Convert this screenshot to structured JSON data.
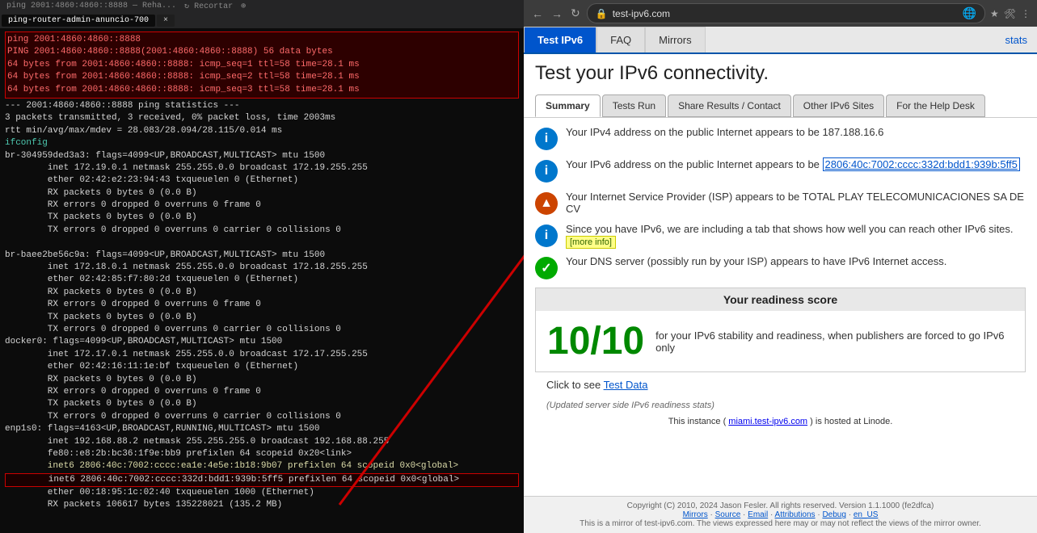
{
  "terminal": {
    "tabs": [
      {
        "label": "ping-router-admin-anuncio-700",
        "active": true
      },
      {
        "label": "×",
        "active": false
      }
    ],
    "lines": [
      {
        "text": "ping 2001:4860:4860::8888",
        "class": "t-red"
      },
      {
        "text": "PING 2001:4860:4860::8888(2001:4860:4860::8888) 56 data bytes",
        "class": "t-red"
      },
      {
        "text": "64 bytes from 2001:4860:4860::8888: icmp_seq=1 ttl=58 time=28.1 ms",
        "class": "t-red"
      },
      {
        "text": "64 bytes from 2001:4860:4860::8888: icmp_seq=2 ttl=58 time=28.1 ms",
        "class": "t-red"
      },
      {
        "text": "64 bytes from 2001:4860:4860::8888: icmp_seq=3 ttl=58 time=28.1 ms",
        "class": "t-red"
      },
      {
        "text": "",
        "class": ""
      },
      {
        "text": "--- 2001:4860:4860::8888 ping statistics ---",
        "class": "t-white"
      },
      {
        "text": "3 packets transmitted, 3 received, 0% packet loss, time 2003ms",
        "class": "t-white"
      },
      {
        "text": "rtt min/avg/max/mdev = 28.083/28.094/28.115/0.014 ms",
        "class": "t-white"
      },
      {
        "text": "ifconfig",
        "class": "t-green"
      },
      {
        "text": "br-304959ded3a3: flags=4099<UP,BROADCAST,MULTICAST>  mtu 1500",
        "class": "t-white"
      },
      {
        "text": "        inet 172.19.0.1  netmask 255.255.0.0  broadcast 172.19.255.255",
        "class": "t-white"
      },
      {
        "text": "        ether 02:42:e2:23:94:43  txqueuelen 0  (Ethernet)",
        "class": "t-white"
      },
      {
        "text": "        RX packets 0  bytes 0 (0.0 B)",
        "class": "t-white"
      },
      {
        "text": "        RX errors 0  dropped 0  overruns 0  frame 0",
        "class": "t-white"
      },
      {
        "text": "        TX packets 0  bytes 0 (0.0 B)",
        "class": "t-white"
      },
      {
        "text": "        TX errors 0  dropped 0 overruns 0  carrier 0  collisions 0",
        "class": "t-white"
      },
      {
        "text": "",
        "class": ""
      },
      {
        "text": "br-baee2be56c9a: flags=4099<UP,BROADCAST,MULTICAST>  mtu 1500",
        "class": "t-white"
      },
      {
        "text": "        inet 172.18.0.1  netmask 255.255.0.0  broadcast 172.18.255.255",
        "class": "t-white"
      },
      {
        "text": "        ether 02:42:85:f7:80:2d  txqueuelen 0  (Ethernet)",
        "class": "t-white"
      },
      {
        "text": "        RX packets 0  bytes 0 (0.0 B)",
        "class": "t-white"
      },
      {
        "text": "        RX errors 0  dropped 0  overruns 0  frame 0",
        "class": "t-white"
      },
      {
        "text": "        TX packets 0  bytes 0 (0.0 B)",
        "class": "t-white"
      },
      {
        "text": "        TX errors 0  dropped 0 overruns 0  carrier 0  collisions 0",
        "class": "t-white"
      },
      {
        "text": "docker0: flags=4099<UP,BROADCAST,MULTICAST>  mtu 1500",
        "class": "t-white"
      },
      {
        "text": "        inet 172.17.0.1  netmask 255.255.0.0  broadcast 172.17.255.255",
        "class": "t-white"
      },
      {
        "text": "        ether 02:42:16:11:1e:bf  txqueuelen 0  (Ethernet)",
        "class": "t-white"
      },
      {
        "text": "        RX packets 0  bytes 0 (0.0 B)",
        "class": "t-white"
      },
      {
        "text": "        RX errors 0  dropped 0  overruns 0  frame 0",
        "class": "t-white"
      },
      {
        "text": "        TX packets 0  bytes 0 (0.0 B)",
        "class": "t-white"
      },
      {
        "text": "        TX errors 0  dropped 0 overruns 0  carrier 0  collisions 0",
        "class": "t-white"
      },
      {
        "text": "enp1s0: flags=4163<UP,BROADCAST,RUNNING,MULTICAST>  mtu 1500",
        "class": "t-white"
      },
      {
        "text": "        inet 192.168.88.2  netmask 255.255.255.0  broadcast 192.168.88.255",
        "class": "t-white"
      },
      {
        "text": "        fe80::e8:2b:bc36:1f9e:bb9  prefixlen 64  scopeid 0x20<link>",
        "class": "t-white"
      },
      {
        "text": "        inet6 2806:40c:7002:cccc:ea1e:4e5e:1b18:9b07  prefixlen 64  scopeid 0x0<global>",
        "class": "t-yellow"
      },
      {
        "text": "        inet6 2806:40c:7002:cccc:332d:bdd1:939b:5ff5  prefixlen 64  scopeid 0x0<global>",
        "class": "inet6-box-line"
      },
      {
        "text": "        ether 00:18:95:1c:02:40  txqueuelen 1000  (Ethernet)",
        "class": "t-white"
      },
      {
        "text": "        RX packets 106617  bytes 135228021 (135.2 MB)",
        "class": "t-white"
      }
    ]
  },
  "browser": {
    "url": "test-ipv6.com",
    "nav_tabs": [
      {
        "label": "Test IPv6",
        "active": true
      },
      {
        "label": "FAQ",
        "active": false
      },
      {
        "label": "Mirrors",
        "active": false
      }
    ],
    "stats_label": "stats",
    "page_title": "Test your IPv6 connectivity.",
    "content_tabs": [
      {
        "label": "Summary",
        "active": true
      },
      {
        "label": "Tests Run",
        "active": false
      },
      {
        "label": "Share Results / Contact",
        "active": false
      },
      {
        "label": "Other IPv6 Sites",
        "active": false
      },
      {
        "label": "For the Help Desk",
        "active": false
      }
    ],
    "results": [
      {
        "icon": "i",
        "icon_class": "icon-blue",
        "text": "Your IPv4 address on the public Internet appears to be 187.188.16.6"
      },
      {
        "icon": "i",
        "icon_class": "icon-blue",
        "text_before": "Your IPv6 address on the public Internet appears to be ",
        "ipv6": "2806:40c:7002:cccc:332d:bdd1:939b:5ff5",
        "text_after": ""
      },
      {
        "icon": "▲",
        "icon_class": "icon-orange",
        "text": "Your Internet Service Provider (ISP) appears to be TOTAL PLAY TELECOMUNICACIONES SA DE CV"
      },
      {
        "icon": "i",
        "icon_class": "icon-blue",
        "text_before": "Since you have IPv6, we are including a tab that shows how well you can reach other IPv6 sites. ",
        "more_info": "[more info]",
        "text_after": ""
      },
      {
        "icon": "✓",
        "icon_class": "icon-green",
        "text": "Your DNS server (possibly run by your ISP) appears to have IPv6 Internet access."
      }
    ],
    "readiness": {
      "header": "Your readiness score",
      "score": "10/10",
      "description": "for your IPv6 stability and readiness, when publishers are forced to go IPv6 only"
    },
    "test_data_label": "Click to see ",
    "test_data_link": "Test Data",
    "stats_note": "(Updated server side IPv6 readiness stats)",
    "linode_note": "This instance (miami.test-ipv6.com) is hosted at Linode.",
    "footer": {
      "copyright": "Copyright (C) 2010, 2024 Jason Fesler. All rights reserved. Version 1.1.1000 (fe2dfca)",
      "links": [
        "Mirrors",
        "Source",
        "Email",
        "Attributions",
        "Debug"
      ],
      "locale": "en_US",
      "mirror_note": "This is a mirror of test-ipv6.com. The views expressed here may or may not reflect the views of the mirror owner."
    }
  }
}
